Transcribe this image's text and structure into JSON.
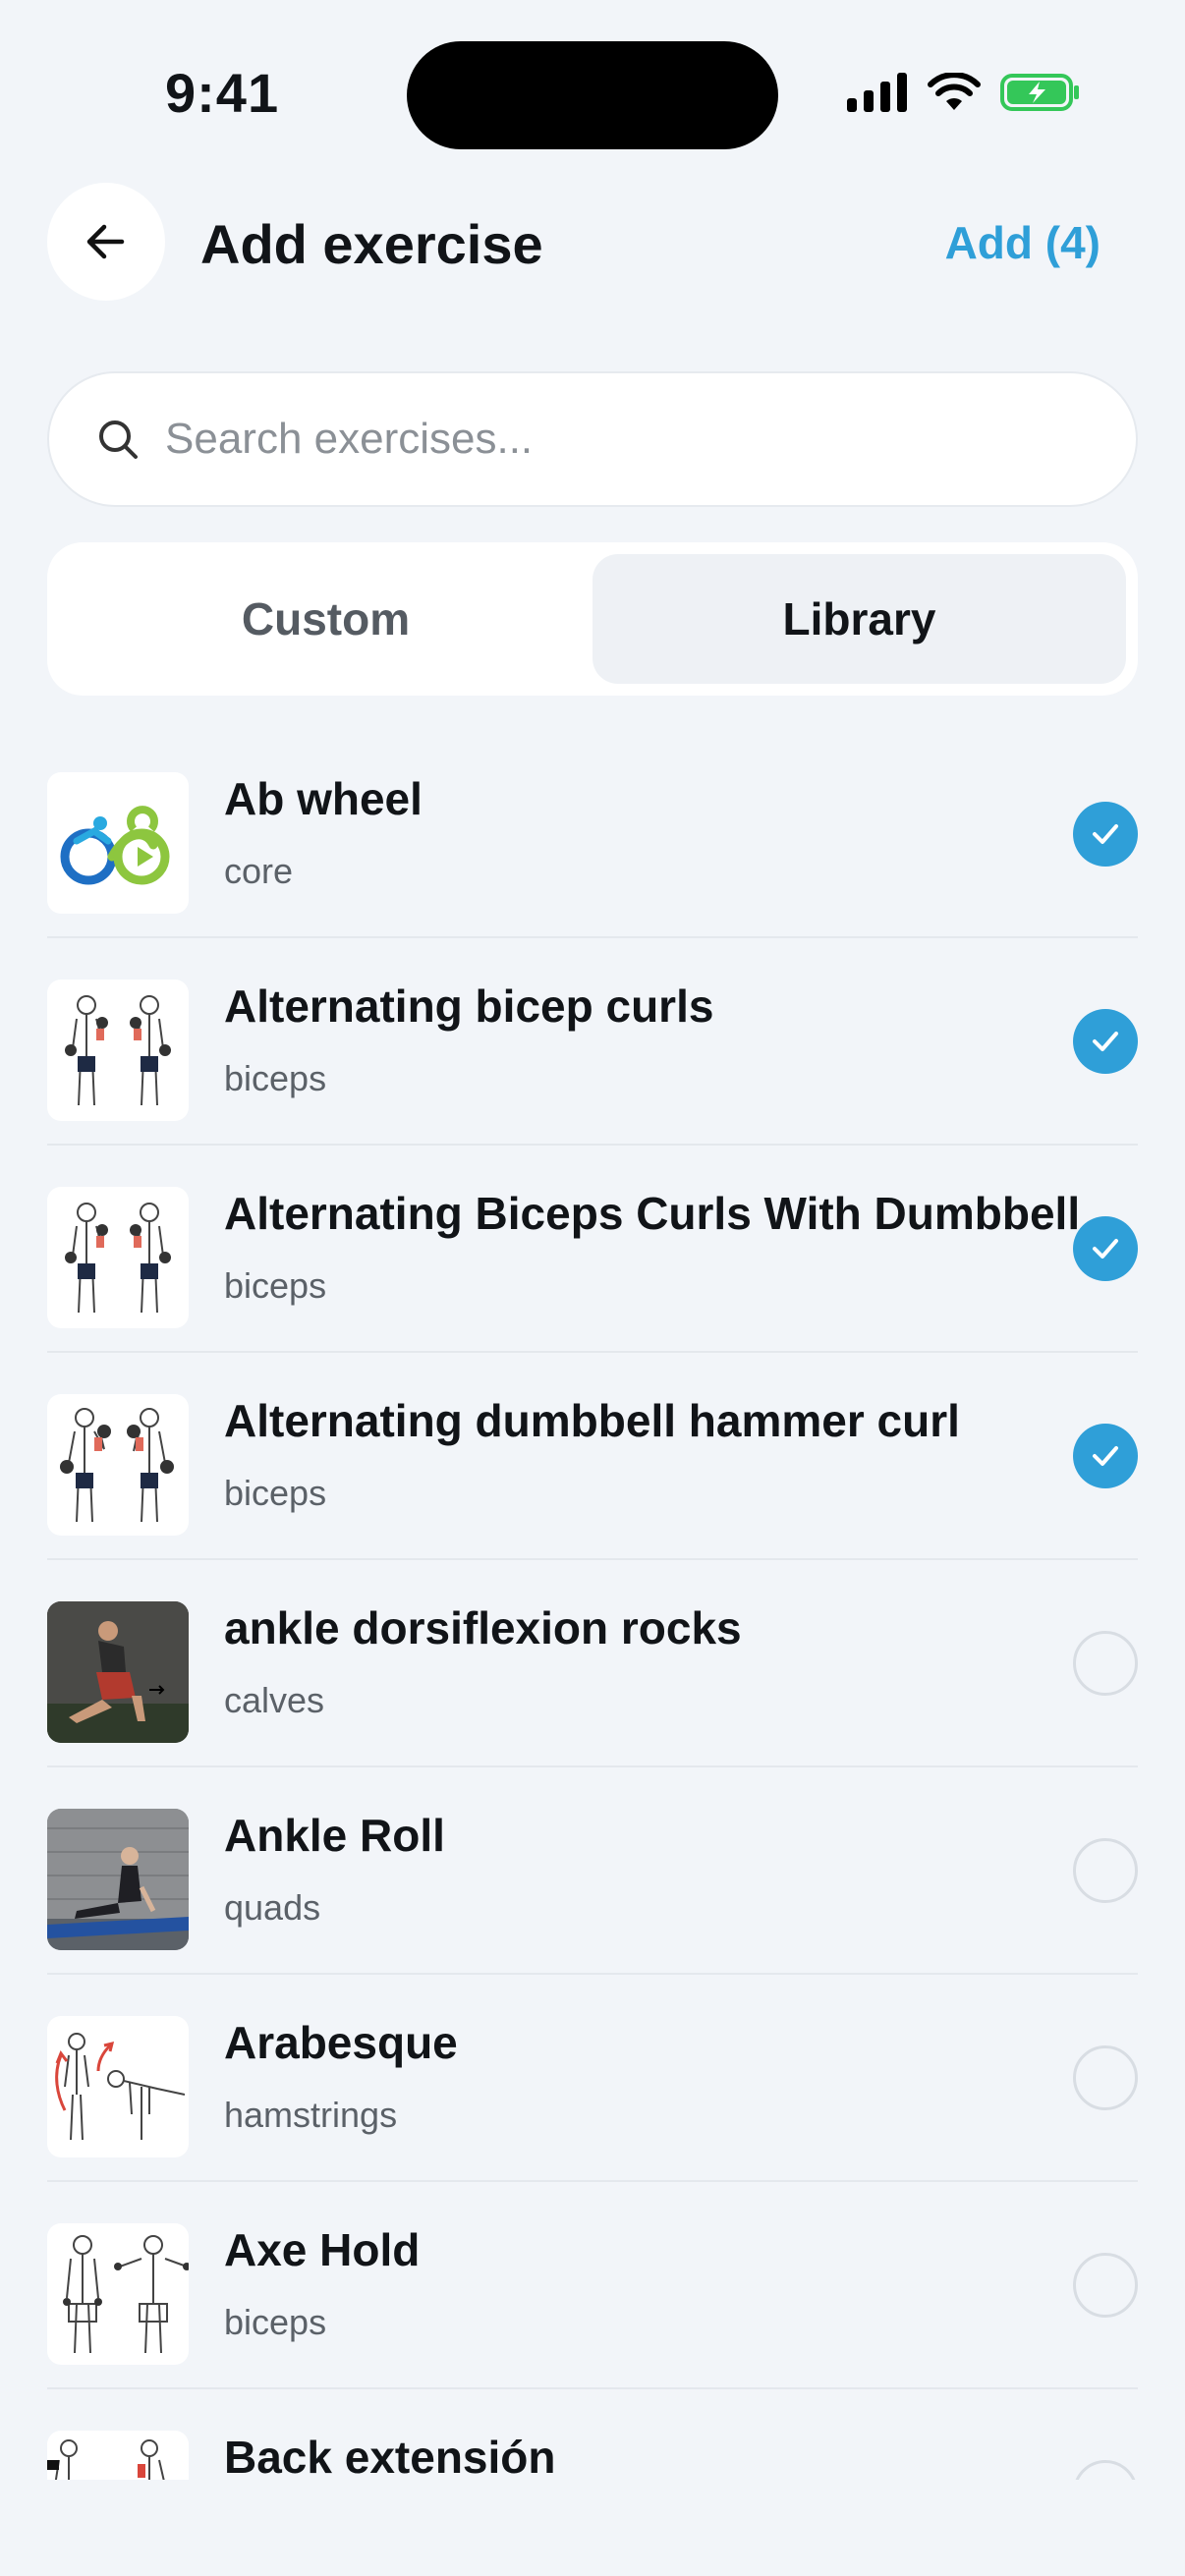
{
  "status": {
    "time": "9:41"
  },
  "header": {
    "title": "Add exercise",
    "add_label": "Add (4)"
  },
  "search": {
    "placeholder": "Search exercises..."
  },
  "tabs": [
    {
      "label": "Custom",
      "active": false
    },
    {
      "label": "Library",
      "active": true
    }
  ],
  "accent": "#2f9fd8",
  "exercises": [
    {
      "name": "Ab wheel",
      "category": "core",
      "selected": true,
      "thumb": "logo-icon"
    },
    {
      "name": "Alternating bicep curls",
      "category": "biceps",
      "selected": true,
      "thumb": "curl-illustration"
    },
    {
      "name": "Alternating Biceps Curls With Dumbbell",
      "category": "biceps",
      "selected": true,
      "thumb": "curl-illustration"
    },
    {
      "name": "Alternating dumbbell hammer curl",
      "category": "biceps",
      "selected": true,
      "thumb": "hammer-curl-illustration"
    },
    {
      "name": "ankle dorsiflexion rocks",
      "category": "calves",
      "selected": false,
      "thumb": "photo"
    },
    {
      "name": "Ankle Roll",
      "category": "quads",
      "selected": false,
      "thumb": "photo"
    },
    {
      "name": "Arabesque",
      "category": "hamstrings",
      "selected": false,
      "thumb": "arabesque-illustration"
    },
    {
      "name": "Axe Hold",
      "category": "biceps",
      "selected": false,
      "thumb": "axe-hold-illustration"
    },
    {
      "name": "Back extensión",
      "category": "",
      "selected": false,
      "thumb": "back-extension-illustration"
    }
  ]
}
